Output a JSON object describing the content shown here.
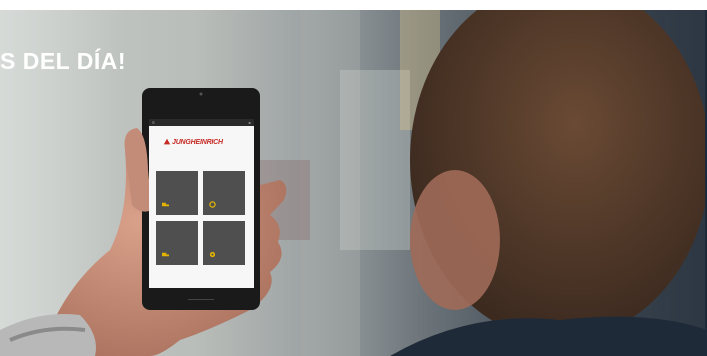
{
  "headline": "S DEL DÍA!",
  "phone": {
    "brand": "JUNGHEINRICH",
    "tiles": [
      {
        "icon": "forklift-icon",
        "color": "#e5b400"
      },
      {
        "icon": "refresh-icon",
        "color": "#e5b400"
      },
      {
        "icon": "truck-icon",
        "color": "#e5b400"
      },
      {
        "icon": "gear-icon",
        "color": "#e5b400"
      }
    ]
  },
  "colors": {
    "accent": "#c62a24",
    "tile": "#4f4f4f",
    "icon": "#e5b400"
  }
}
